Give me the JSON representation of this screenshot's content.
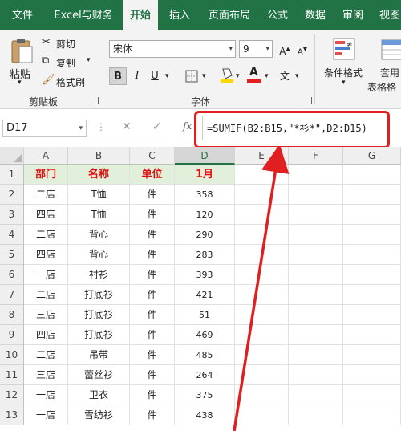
{
  "tabs": [
    {
      "label": "文件"
    },
    {
      "label": "Excel与财务"
    },
    {
      "label": "开始"
    },
    {
      "label": "插入"
    },
    {
      "label": "页面布局"
    },
    {
      "label": "公式"
    },
    {
      "label": "数据"
    },
    {
      "label": "审阅"
    },
    {
      "label": "视图"
    }
  ],
  "clipboard": {
    "paste": "粘贴",
    "cut": "剪切",
    "copy": "复制",
    "format_painter": "格式刷",
    "group_label": "剪贴板"
  },
  "font": {
    "name": "宋体",
    "size": "9",
    "group_label": "字体",
    "bold": "B",
    "italic": "I",
    "underline": "U",
    "font_color": "#e02020",
    "fill_color": "#ffd700"
  },
  "styles": {
    "conditional": "条件格式",
    "table_format": "套用",
    "table_format2": "表格格"
  },
  "formula_bar": {
    "name_box": "D17",
    "cancel": "✕",
    "enter": "✓",
    "fx": "fx",
    "formula": "=SUMIF(B2:B15,\"*衫*\",D2:D15)"
  },
  "columns": [
    "A",
    "B",
    "C",
    "D",
    "E",
    "F",
    "G"
  ],
  "rows": [
    "1",
    "2",
    "3",
    "4",
    "5",
    "6",
    "7",
    "8",
    "9",
    "10",
    "11",
    "12",
    "13"
  ],
  "header_row": [
    "部门",
    "名称",
    "单位",
    "1月"
  ],
  "data": [
    [
      "二店",
      "T恤",
      "件",
      "358"
    ],
    [
      "四店",
      "T恤",
      "件",
      "120"
    ],
    [
      "二店",
      "背心",
      "件",
      "290"
    ],
    [
      "四店",
      "背心",
      "件",
      "283"
    ],
    [
      "一店",
      "衬衫",
      "件",
      "393"
    ],
    [
      "二店",
      "打底衫",
      "件",
      "421"
    ],
    [
      "三店",
      "打底衫",
      "件",
      "51"
    ],
    [
      "四店",
      "打底衫",
      "件",
      "469"
    ],
    [
      "二店",
      "吊带",
      "件",
      "485"
    ],
    [
      "三店",
      "蕾丝衫",
      "件",
      "264"
    ],
    [
      "一店",
      "卫衣",
      "件",
      "375"
    ],
    [
      "一店",
      "雪纺衫",
      "件",
      "438"
    ]
  ],
  "colors": {
    "brand": "#217346",
    "highlight": "#e02020",
    "header_fill": "#e2efda"
  }
}
